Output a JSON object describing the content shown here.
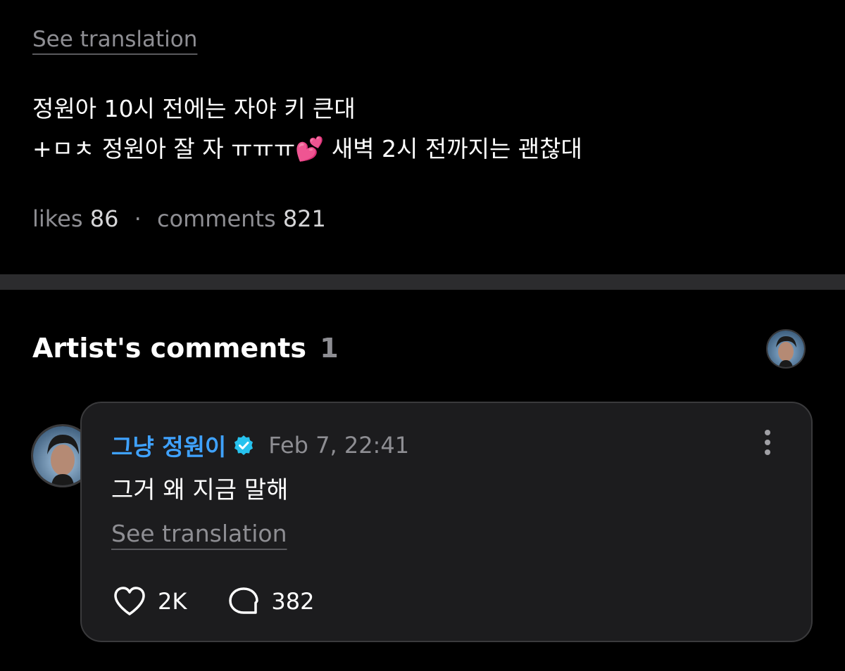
{
  "post": {
    "see_translation": "See translation",
    "body_line1": "정원아 10시 전에는 자야 키 큰대",
    "body_line2_prefix": "+ㅁㅊ 정원아 잘 자 ㅠㅠㅠ",
    "body_line2_emoji": "💕",
    "body_line2_suffix": "새벽 2시 전까지는 괜찮대",
    "likes_label": "likes",
    "likes_count": "86",
    "separator": "·",
    "comments_label": "comments",
    "comments_count": "821"
  },
  "artist_section": {
    "title": "Artist's comments",
    "count": "1"
  },
  "comment": {
    "author": "그냥 정원이",
    "timestamp": "Feb 7, 22:41",
    "text": "그거 왜 지금 말해",
    "see_translation": "See translation",
    "likes": "2K",
    "replies": "382"
  },
  "icons": {
    "verified": "verified-badge-icon",
    "more": "more-vertical-icon",
    "like": "heart-icon",
    "reply": "comment-bubble-icon"
  },
  "colors": {
    "background": "#000000",
    "card": "#1c1c1e",
    "author_blue": "#3fa2ff",
    "verified_teal": "#27c2ee",
    "muted": "#8e8e93"
  }
}
